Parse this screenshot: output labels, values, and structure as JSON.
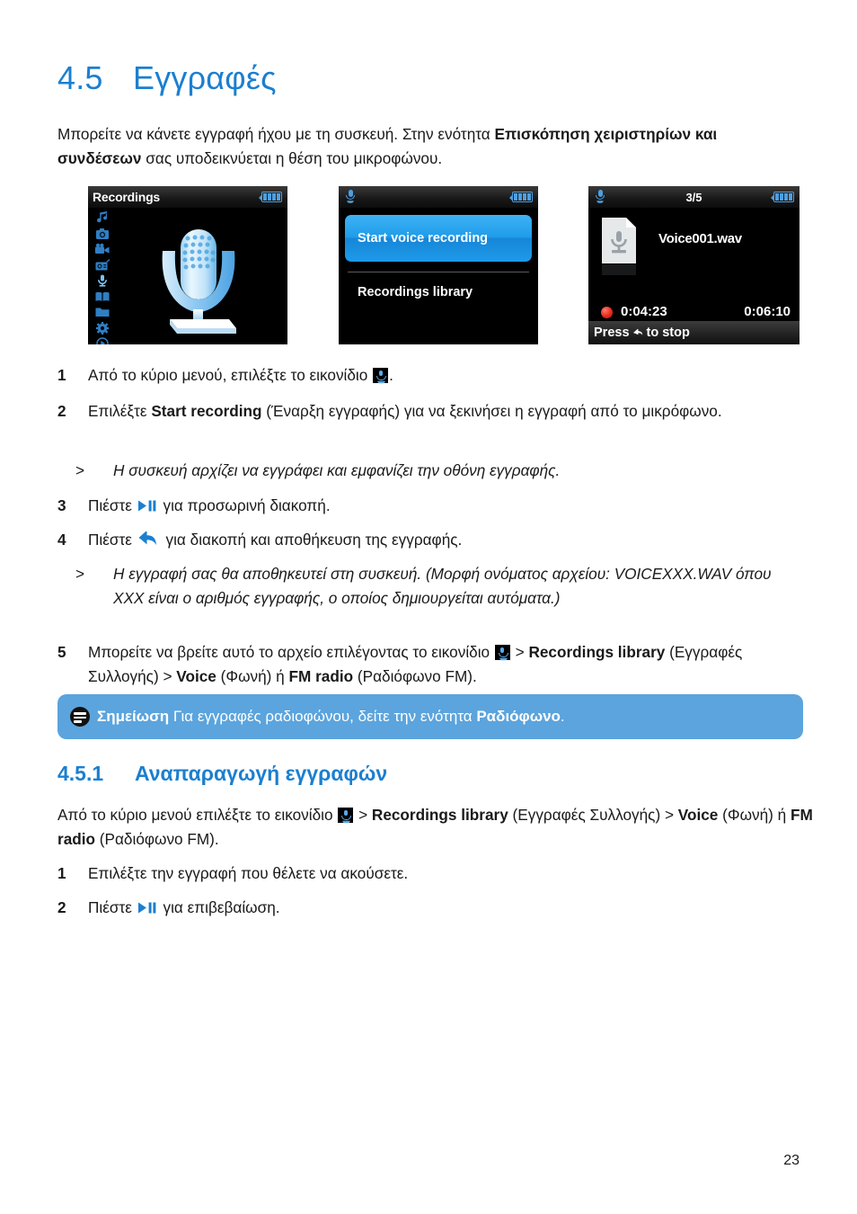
{
  "colors": {
    "accent_blue": "#1b7fd0",
    "note_box_blue": "#5ba4dd",
    "screen_blue": "#4d9fe0",
    "text": "#1a1a1a"
  },
  "heading": {
    "number": "4.5",
    "title": "Εγγραφές"
  },
  "intro": {
    "t1": "Μπορείτε να κάνετε εγγραφή ήχου με τη συσκευή. Στην ενότητα ",
    "b1": "Επισκόπηση χειριστηρίων και συνδέσεων",
    "t2": " σας υποδεικνύεται η θέση του μικροφώνου."
  },
  "screens": {
    "screen1": {
      "title": "Recordings",
      "battery_label": "battery-full",
      "sidebar_icons": [
        "music-note-icon",
        "photo-camera-icon",
        "video-camera-icon",
        "fm-radio-icon",
        "microphone-icon",
        "book-icon",
        "folder-icon",
        "settings-gear-icon",
        "play-circle-icon"
      ],
      "hero_icon": "microphone-hero-icon"
    },
    "screen2": {
      "title_icon": "microphone-icon",
      "selected_item": "Start voice recording",
      "item_2": "Recordings library"
    },
    "screen3": {
      "title_icon": "microphone-icon",
      "counter": "3/5",
      "file_icon": "wav-file-icon",
      "file_name": "Voice001.wav",
      "record_indicator": "record-dot-icon",
      "elapsed_time": "0:04:23",
      "total_time": "0:06:10",
      "footer_prefix": "Press ",
      "footer_icon": "back-arrow-icon",
      "footer_suffix": " to stop"
    }
  },
  "steps_a": [
    {
      "marker": "1",
      "t1": "Από το κύριο μενού, επιλέξτε το εικονίδιο ",
      "icon": "microphone-icon",
      "t2": "."
    },
    {
      "marker": "2",
      "t1": "Επιλέξτε ",
      "b1": "Start recording",
      "t2": " (Έναρξη εγγραφής) για να ξεκινήσει η εγγραφή από το μικρόφωνο."
    }
  ],
  "sub_a": {
    "marker": ">",
    "text": "Η συσκευή αρχίζει να εγγράφει και εμφανίζει την οθόνη εγγραφής."
  },
  "steps_b": [
    {
      "marker": "3",
      "t1": "Πιέστε ",
      "icon": "play-pause-icon",
      "t2": " για προσωρινή διακοπή."
    },
    {
      "marker": "4",
      "t1": "Πιέστε ",
      "icon": "back-arrow-icon",
      "t2": " για διακοπή και αποθήκευση της εγγραφής."
    }
  ],
  "sub_b": {
    "marker": ">",
    "text": "Η εγγραφή σας θα αποθηκευτεί στη συσκευή. (Μορφή ονόματος αρχείου: VOICEXXX.WAV όπου XXX είναι ο αριθμός εγγραφής, ο οποίος δημιουργείται αυτόματα.)"
  },
  "step5": {
    "marker": "5",
    "t1": "Μπορείτε να βρείτε αυτό το αρχείο επιλέγοντας το εικονίδιο ",
    "icon": "microphone-icon",
    "t2": " > ",
    "b1": "Recordings library",
    "t3": " (Εγγραφές Συλλογής) > ",
    "b2": "Voice",
    "t4": " (Φωνή) ή ",
    "b3": "FM radio",
    "t5": " (Ραδιόφωνο FM)."
  },
  "note": {
    "icon": "note-icon",
    "label": "Σημείωση",
    "t1": " Για εγγραφές ραδιοφώνου, δείτε την ενότητα ",
    "b1": "Ραδιόφωνο",
    "t2": "."
  },
  "subheading": {
    "number": "4.5.1",
    "title": "Αναπαραγωγή εγγραφών"
  },
  "lead2": {
    "t1": "Από το κύριο μενού επιλέξτε το εικονίδιο ",
    "icon": "microphone-icon",
    "t2": " > ",
    "b1": "Recordings library",
    "t3": " (Εγγραφές Συλλογής) > ",
    "b2": "Voice",
    "t4": " (Φωνή) ή ",
    "b3": "FM radio",
    "t5": " (Ραδιόφωνο FM)."
  },
  "steps_c": [
    {
      "marker": "1",
      "text": "Επιλέξτε την εγγραφή που θέλετε να ακούσετε."
    },
    {
      "marker": "2",
      "t1": "Πιέστε ",
      "icon": "play-pause-icon",
      "t2": " για επιβεβαίωση."
    }
  ],
  "page_number": "23"
}
